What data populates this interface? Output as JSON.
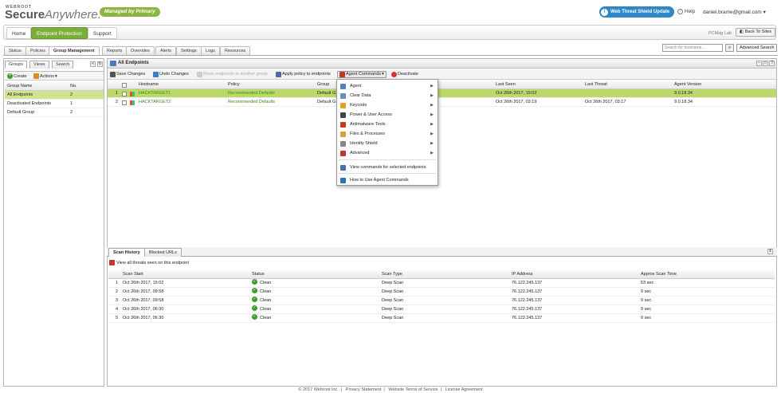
{
  "header": {
    "logo_small": "WEBROOT",
    "logo_main": "Secure",
    "logo_italic": "Anywhere.",
    "managed_badge": "Managed by Primary",
    "wts_button": "Web Threat Shield Update",
    "help": "Help",
    "user": "daniel.brame@gmail.com"
  },
  "mainnav": {
    "tabs": [
      "Home",
      "Endpoint Protection",
      "Support"
    ],
    "site_label": "PCMag Lab",
    "back_to_sites": "Back To Sites"
  },
  "subnav": {
    "tabs": [
      "Status",
      "Policies",
      "Group Management",
      "Reports",
      "Overrides",
      "Alerts",
      "Settings",
      "Logs",
      "Resources"
    ],
    "search_placeholder": "Search for hostname...",
    "advanced_search": "Advanced Search"
  },
  "leftpanel": {
    "tabs": [
      "Groups",
      "Views",
      "Search"
    ],
    "create": "Create",
    "actions": "Actions",
    "columns": [
      "Group Name",
      "No."
    ],
    "rows": [
      {
        "name": "All Endpoints",
        "count": "2"
      },
      {
        "name": "Deactivated Endpoints",
        "count": "1"
      },
      {
        "name": "Default Group",
        "count": "2"
      }
    ]
  },
  "endpoints": {
    "title": "All Endpoints",
    "toolbar": {
      "save": "Save Changes",
      "undo": "Undo Changes",
      "move": "Move endpoints to another group",
      "apply": "Apply policy to endpoints",
      "agent_commands": "Agent Commands",
      "deactivate": "Deactivate"
    },
    "columns": [
      "Hostname",
      "Policy",
      "Group",
      "Last Seen",
      "Last Threat",
      "Agent Version"
    ],
    "rows": [
      {
        "num": "1",
        "hostname": "HACKTARGET1",
        "policy": "Recommended Defaults",
        "group": "Default G",
        "last_seen": "Oct 26th 2017, 15:02",
        "last_threat": "",
        "version": "9.0.18.34"
      },
      {
        "num": "2",
        "hostname": "HACKTARGET2",
        "policy": "Recommended Defaults",
        "group": "Default G",
        "last_seen": "Oct 26th 2017, 03:19",
        "last_threat": "Oct 26th 2017, 03:17",
        "version": "9.0.18.34"
      }
    ]
  },
  "agent_menu": {
    "items": [
      {
        "label": "Agent",
        "color": "#5b7fb5",
        "sub": true
      },
      {
        "label": "Clear Data",
        "color": "#6c8ebf",
        "sub": true
      },
      {
        "label": "Keycode",
        "color": "#e0a020",
        "sub": true
      },
      {
        "label": "Power & User Access",
        "color": "#444444",
        "sub": true
      },
      {
        "label": "Antimalware Tools",
        "color": "#c0392b",
        "sub": true
      },
      {
        "label": "Files & Processes",
        "color": "#d4a43a",
        "sub": true
      },
      {
        "label": "Identity Shield",
        "color": "#888888",
        "sub": true
      },
      {
        "label": "Advanced",
        "color": "#c0392b",
        "sub": true
      },
      {
        "label": "View commands for selected endpoints",
        "color": "#4a6fa5",
        "sub": false
      },
      {
        "label": "How to Use Agent Commands",
        "color": "#2f6fb8",
        "sub": false
      }
    ]
  },
  "scan": {
    "tabs": [
      "Scan History",
      "Blocked URLs"
    ],
    "view_threats": "View all threats seen on this endpoint",
    "columns": [
      "Scan Start",
      "Status",
      "Scan Type",
      "IP Address",
      "Approx Scan Time"
    ],
    "rows": [
      {
        "num": "1",
        "start": "Oct 26th 2017, 15:02",
        "status": "Clean",
        "type": "Deep Scan",
        "ip": "76.122.245.137",
        "time": "53 sec"
      },
      {
        "num": "2",
        "start": "Oct 26th 2017, 09:58",
        "status": "Clean",
        "type": "Deep Scan",
        "ip": "76.122.245.137",
        "time": "9 sec"
      },
      {
        "num": "3",
        "start": "Oct 26th 2017, 09:58",
        "status": "Clean",
        "type": "Deep Scan",
        "ip": "76.122.245.137",
        "time": "9 sec"
      },
      {
        "num": "4",
        "start": "Oct 26th 2017, 06:30",
        "status": "Clean",
        "type": "Deep Scan",
        "ip": "76.122.245.137",
        "time": "9 sec"
      },
      {
        "num": "5",
        "start": "Oct 26th 2017, 06:30",
        "status": "Clean",
        "type": "Deep Scan",
        "ip": "76.122.245.137",
        "time": "9 sec"
      }
    ]
  },
  "footer": {
    "copyright": "© 2017 Webroot Inc.",
    "links": [
      "Privacy Statement",
      "Website Terms of Service",
      "License Agreement"
    ]
  }
}
